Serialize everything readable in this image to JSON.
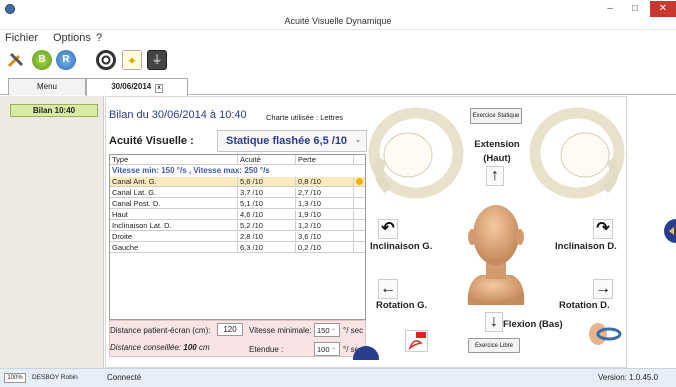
{
  "window": {
    "title": "Acuité Visuelle Dynamique",
    "minimize": "–",
    "maximize": "□",
    "close": "✕"
  },
  "menu": {
    "fichier": "Fichier",
    "options": "Options",
    "help": "?"
  },
  "tabs": [
    {
      "label": "Menu"
    },
    {
      "label": "30/06/2014",
      "close": "x"
    }
  ],
  "sidebar": {
    "session_label": "Bilan 10:40"
  },
  "bilan": {
    "title": "Bilan du  30/06/2014  à   10:40",
    "charte": "Charte utilisée :  Lettres"
  },
  "acuite": {
    "label": "Acuité Visuelle :",
    "selected": "Statique flashée   6,5 /10",
    "chevron": "⌄"
  },
  "table": {
    "headers": [
      "Type",
      "Acuité",
      "Perte"
    ],
    "speed": "Vitesse min: 150 °/s , Vitesse max: 250 °/s",
    "rows": [
      {
        "type": "Canal Ant. G.",
        "acuite": "5,6 /10",
        "perte": "0,8 /10",
        "selected": true
      },
      {
        "type": "Canal Lat. G.",
        "acuite": "3,7 /10",
        "perte": "2,7 /10"
      },
      {
        "type": "Canal Post. D.",
        "acuite": "5,1 /10",
        "perte": "1,3 /10"
      },
      {
        "type": "Haut",
        "acuite": "4,6 /10",
        "perte": "1,9 /10"
      },
      {
        "type": "Inclinaison Lat. D.",
        "acuite": "5,2 /10",
        "perte": "1,2 /10"
      },
      {
        "type": "Droite",
        "acuite": "2,8 /10",
        "perte": "3,6 /10"
      },
      {
        "type": "Gauche",
        "acuite": "6,3 /10",
        "perte": "0,2 /10"
      }
    ]
  },
  "params": {
    "distance_label": "Distance patient-écran (cm):",
    "distance_value": "120",
    "distance_rec_prefix": "Distance conseillée:",
    "distance_rec_value": "100",
    "distance_rec_unit": "cm",
    "vmin_label": "Vitesse minimale:",
    "vmin_value": "150",
    "vmin_unit": "°/ sec",
    "etendue_label": "Etendue :",
    "etendue_value": "100",
    "etendue_unit": "°/ sec"
  },
  "head": {
    "exercice_statique": "Exercice Statique",
    "exercice_libre": "Exercice Libre",
    "extension": "Extension",
    "haut": "(Haut)",
    "inclinaison_g": "Inclinaison G.",
    "inclinaison_d": "Inclinaison D.",
    "rotation_g": "Rotation G.",
    "rotation_d": "Rotation D.",
    "flexion": "Flexion (Bas)"
  },
  "status": {
    "zoom": "100%",
    "user": "DESBOY Robin",
    "text": "Connecté",
    "version": "Version: 1.0.45.0"
  },
  "colors": {
    "accent": "#2a3d8c",
    "selected_row": "#fbeac0",
    "session": "#d9eaa4",
    "close": "#c7382f"
  }
}
